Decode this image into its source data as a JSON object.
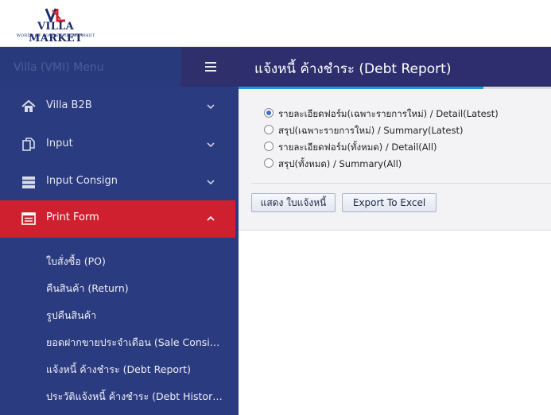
{
  "brand": {
    "name": "VILLA MARKET",
    "tagline": "WORLD OF FOODS SUPERMARKET",
    "logo_mark": "VL",
    "color_navy": "#1e2d6b",
    "color_red": "#cf2030"
  },
  "sidebar": {
    "menu_title": "Villa (VMI) Menu",
    "items": [
      {
        "label": "Villa B2B",
        "icon": "home-icon",
        "expanded": false
      },
      {
        "label": "Input",
        "icon": "copy-icon",
        "expanded": false
      },
      {
        "label": "Input Consign",
        "icon": "server-icon",
        "expanded": false
      },
      {
        "label": "Print Form",
        "icon": "list-icon",
        "expanded": true
      }
    ],
    "sub_items": [
      "ใบสั่งซื้อ (PO)",
      "คืนสินค้า (Return)",
      "รูปคืนสินค้า",
      "ยอดฝากขายประจำเดือน (Sale Consign)",
      "แจ้งหนี้ ค้างชำระ (Debt Report)",
      "ประวัติแจ้งหนี้ ค้างชำระ (Debt History Report)"
    ]
  },
  "page": {
    "title": "แจ้งหนี้ ค้างชำระ (Debt Report)",
    "options": [
      {
        "label": "รายละเอียดฟอร์ม(เฉพาะรายการใหม่) / Detail(Latest)",
        "checked": true
      },
      {
        "label": "สรุป(เฉพาะรายการใหม่) / Summary(Latest)",
        "checked": false
      },
      {
        "label": "รายละเอียดฟอร์ม(ทั้งหมด) / Detail(All)",
        "checked": false
      },
      {
        "label": "สรุป(ทั้งหมด) / Summary(All)",
        "checked": false
      }
    ],
    "buttons": {
      "show": "แสดง ใบแจ้งหนี้",
      "export": "Export To Excel"
    }
  }
}
